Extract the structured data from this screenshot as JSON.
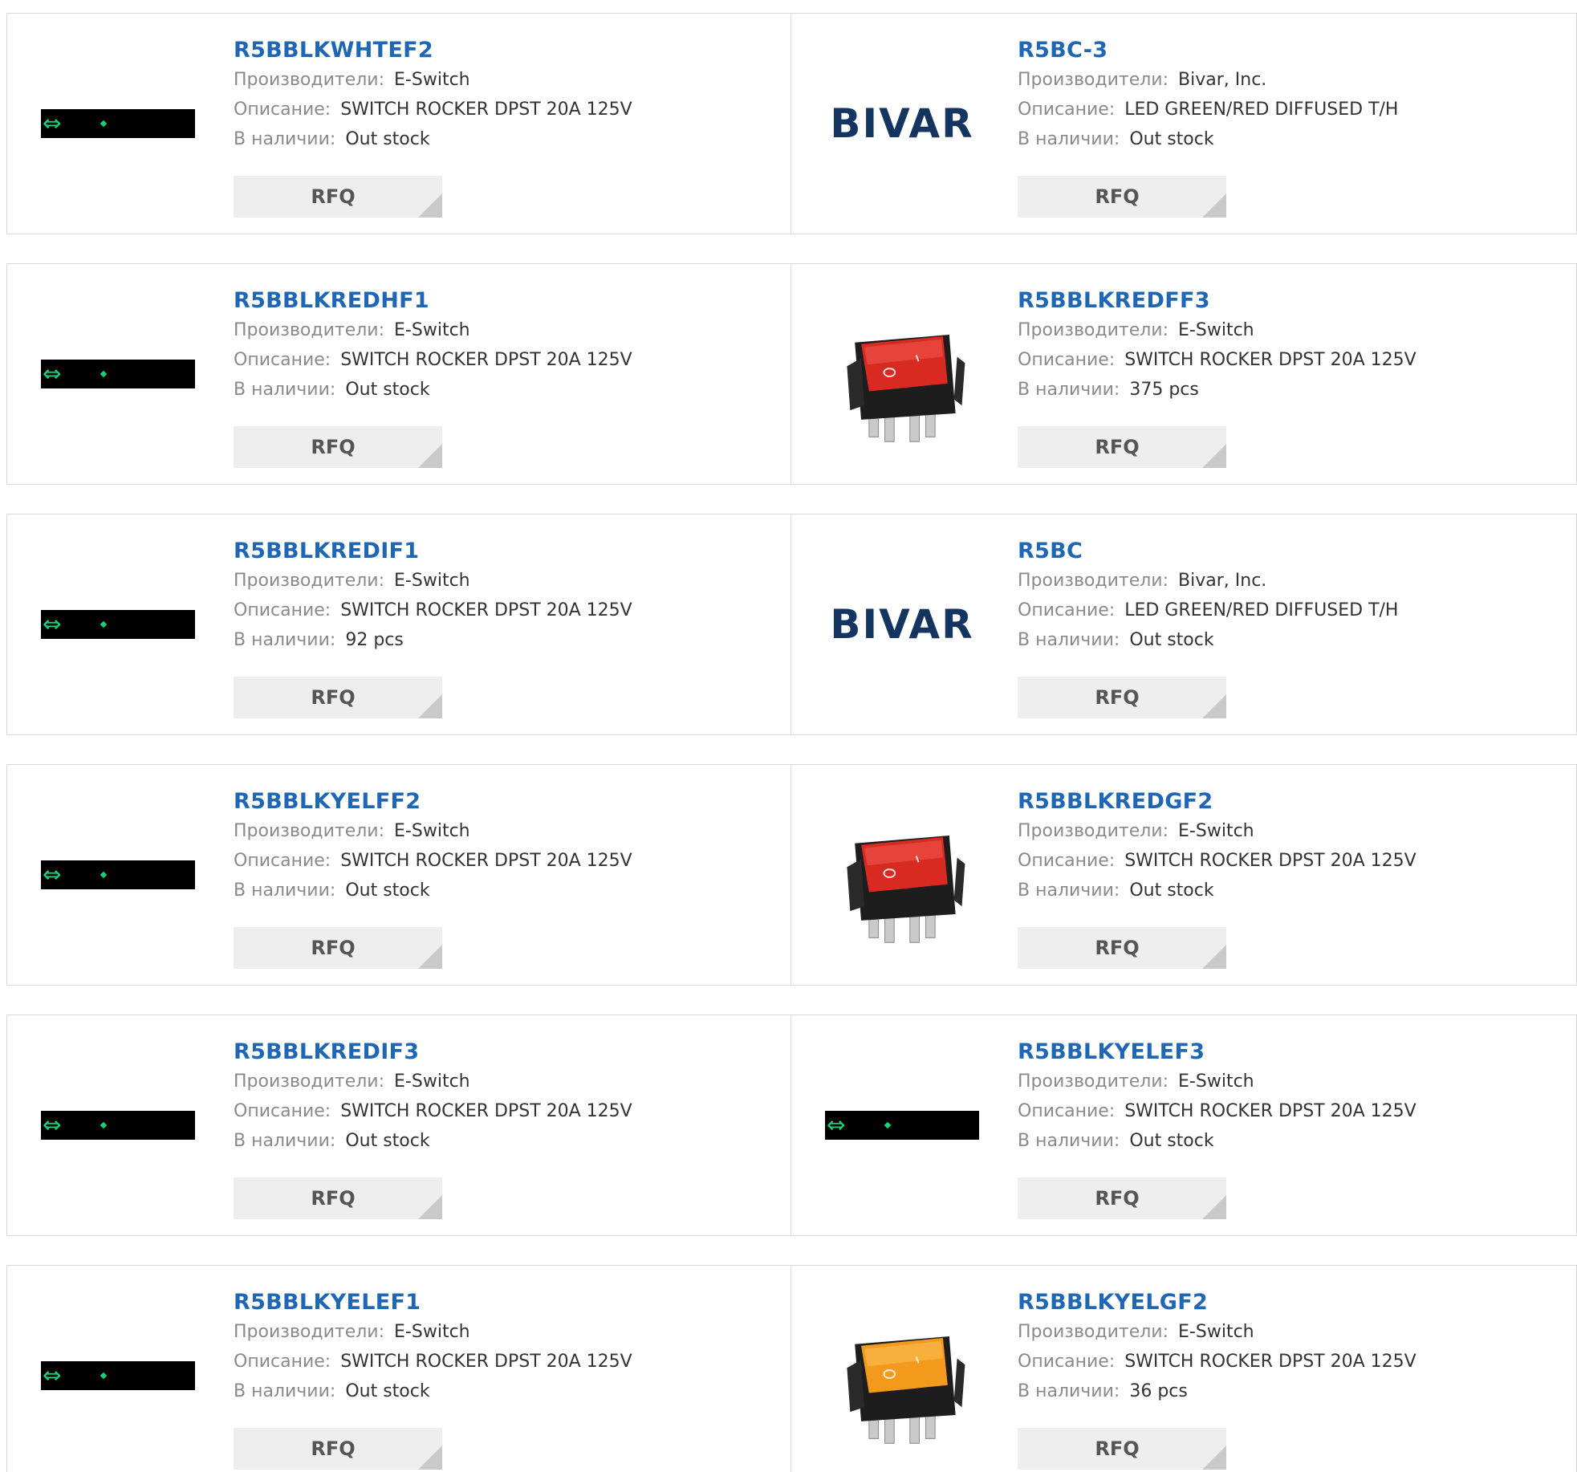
{
  "labels": {
    "manufacturer": "Производители:",
    "description": "Описание:",
    "stock": "В наличии:",
    "rfq": "RFQ"
  },
  "colors": {
    "part_link": "#1f67b5",
    "label_gray": "#8a8a8a",
    "rfq_bg": "#eeeeee",
    "switch_green": "#16d47a",
    "bivar_navy": "#14355f"
  },
  "products": [
    {
      "part": "R5BBLKWHTEF2",
      "manufacturer": "E-Switch",
      "description": "SWITCH ROCKER DPST 20A 125V",
      "stock": "Out stock",
      "image": "e-switch-placeholder"
    },
    {
      "part": "R5BC-3",
      "manufacturer": "Bivar, Inc.",
      "description": "LED GREEN/RED DIFFUSED T/H",
      "stock": "Out stock",
      "image": "bivar-logo",
      "logo_text": "BIVAR"
    },
    {
      "part": "R5BBLKREDHF1",
      "manufacturer": "E-Switch",
      "description": "SWITCH ROCKER DPST 20A 125V",
      "stock": "Out stock",
      "image": "e-switch-placeholder"
    },
    {
      "part": "R5BBLKREDFF3",
      "manufacturer": "E-Switch",
      "description": "SWITCH ROCKER DPST 20A 125V",
      "stock": "375 pcs",
      "image": "red-rocker-switch"
    },
    {
      "part": "R5BBLKREDIF1",
      "manufacturer": "E-Switch",
      "description": "SWITCH ROCKER DPST 20A 125V",
      "stock": "92 pcs",
      "image": "e-switch-placeholder"
    },
    {
      "part": "R5BC",
      "manufacturer": "Bivar, Inc.",
      "description": "LED GREEN/RED DIFFUSED T/H",
      "stock": "Out stock",
      "image": "bivar-logo",
      "logo_text": "BIVAR"
    },
    {
      "part": "R5BBLKYELFF2",
      "manufacturer": "E-Switch",
      "description": "SWITCH ROCKER DPST 20A 125V",
      "stock": "Out stock",
      "image": "e-switch-placeholder"
    },
    {
      "part": "R5BBLKREDGF2",
      "manufacturer": "E-Switch",
      "description": "SWITCH ROCKER DPST 20A 125V",
      "stock": "Out stock",
      "image": "red-rocker-switch"
    },
    {
      "part": "R5BBLKREDIF3",
      "manufacturer": "E-Switch",
      "description": "SWITCH ROCKER DPST 20A 125V",
      "stock": "Out stock",
      "image": "e-switch-placeholder"
    },
    {
      "part": "R5BBLKYELEF3",
      "manufacturer": "E-Switch",
      "description": "SWITCH ROCKER DPST 20A 125V",
      "stock": "Out stock",
      "image": "e-switch-placeholder"
    },
    {
      "part": "R5BBLKYELEF1",
      "manufacturer": "E-Switch",
      "description": "SWITCH ROCKER DPST 20A 125V",
      "stock": "Out stock",
      "image": "e-switch-placeholder"
    },
    {
      "part": "R5BBLKYELGF2",
      "manufacturer": "E-Switch",
      "description": "SWITCH ROCKER DPST 20A 125V",
      "stock": "36 pcs",
      "image": "orange-rocker-switch"
    }
  ]
}
